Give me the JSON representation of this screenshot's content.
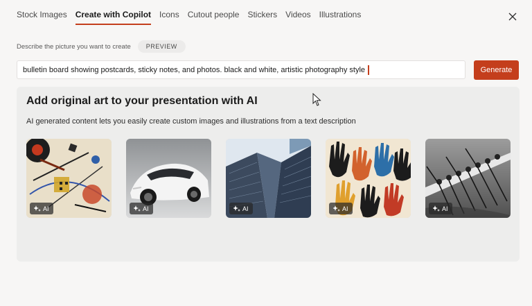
{
  "tabs": [
    {
      "label": "Stock Images",
      "active": false
    },
    {
      "label": "Create with Copilot",
      "active": true
    },
    {
      "label": "Icons",
      "active": false
    },
    {
      "label": "Cutout people",
      "active": false
    },
    {
      "label": "Stickers",
      "active": false
    },
    {
      "label": "Videos",
      "active": false
    },
    {
      "label": "Illustrations",
      "active": false
    }
  ],
  "close_icon": "close-icon",
  "describe": {
    "label": "Describe the picture you want to create",
    "badge": "PREVIEW"
  },
  "prompt": {
    "value": "bulletin board showing postcards, sticky notes, and photos. black and white, artistic photography style"
  },
  "generate_label": "Generate",
  "panel": {
    "title": "Add original art to your presentation with AI",
    "subtitle": "AI generated content lets you easily create custom images and illustrations from a text description"
  },
  "samples": [
    {
      "subject": "abstract-art",
      "badge": "AI"
    },
    {
      "subject": "concept-car",
      "badge": "AI"
    },
    {
      "subject": "skyscrapers",
      "badge": "AI"
    },
    {
      "subject": "raised-hands",
      "badge": "AI"
    },
    {
      "subject": "rowing-crew",
      "badge": "AI"
    }
  ],
  "colors": {
    "accent": "#c43e1c",
    "background": "#f7f6f5",
    "panel": "#ededec"
  }
}
